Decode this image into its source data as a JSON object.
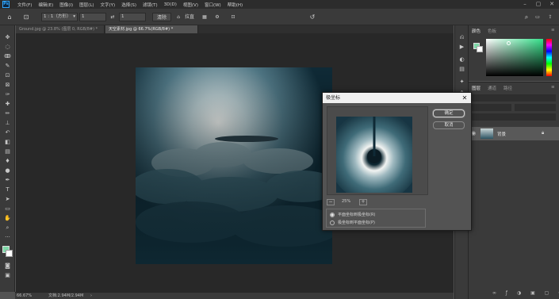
{
  "app": {
    "logo": "Ps"
  },
  "menu": [
    "文件(F)",
    "编辑(E)",
    "图像(I)",
    "图层(L)",
    "文字(Y)",
    "选择(S)",
    "滤镜(T)",
    "3D(D)",
    "视图(V)",
    "窗口(W)",
    "帮助(H)"
  ],
  "options": {
    "ratio_label": "1 : 1（方形）",
    "width_value": "1",
    "height_value": "1",
    "clear_label": "清除",
    "straighten_label": "拉直"
  },
  "tabs": [
    {
      "label": "Ground.jpg @ 23.8% (图层 0, RGB/8#) *",
      "active": false
    },
    {
      "label": "天空素材.jpg @ 66.7%(RGB/8#) *",
      "active": true
    }
  ],
  "status": {
    "zoom": "66.67%",
    "doc_info": "文档:2.94M/2.94M"
  },
  "panels": {
    "color_tab": "颜色",
    "swatches_tab": "色板",
    "layers_tab": "图层",
    "channels_tab": "通道",
    "paths_tab": "路径",
    "layer_name": "背景"
  },
  "dialog": {
    "title": "极坐标",
    "ok_label": "确定",
    "cancel_label": "取消",
    "zoom": "25%",
    "option1": "平面坐标到极坐标(R)",
    "option2": "极坐标到平面坐标(P)",
    "selected_option": 1
  },
  "colors": {
    "foreground": "#7fd8a8",
    "accent": "#31a8ff"
  }
}
